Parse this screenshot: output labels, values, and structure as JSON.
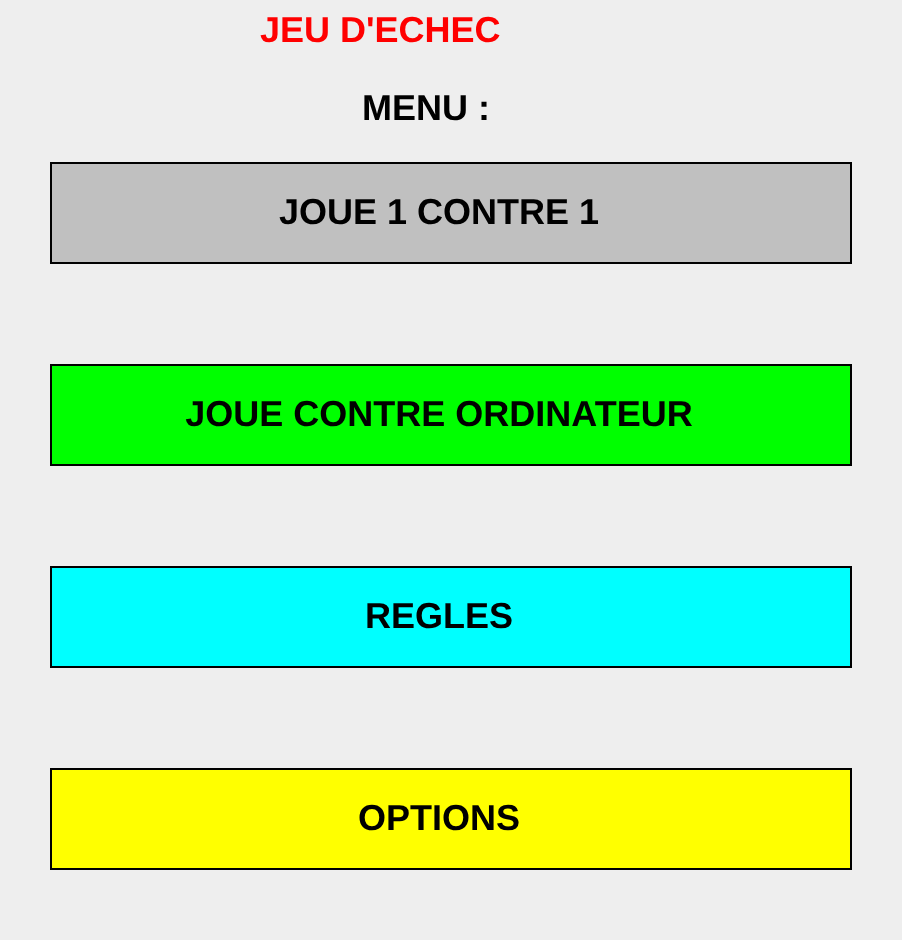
{
  "title": "JEU D'ECHEC",
  "menu_label": "MENU :",
  "buttons": [
    {
      "label": "JOUE 1 CONTRE 1",
      "color": "#c0c0c0"
    },
    {
      "label": "JOUE CONTRE ORDINATEUR",
      "color": "#00ff00"
    },
    {
      "label": "REGLES",
      "color": "#00ffff"
    },
    {
      "label": "OPTIONS",
      "color": "#ffff00"
    }
  ]
}
